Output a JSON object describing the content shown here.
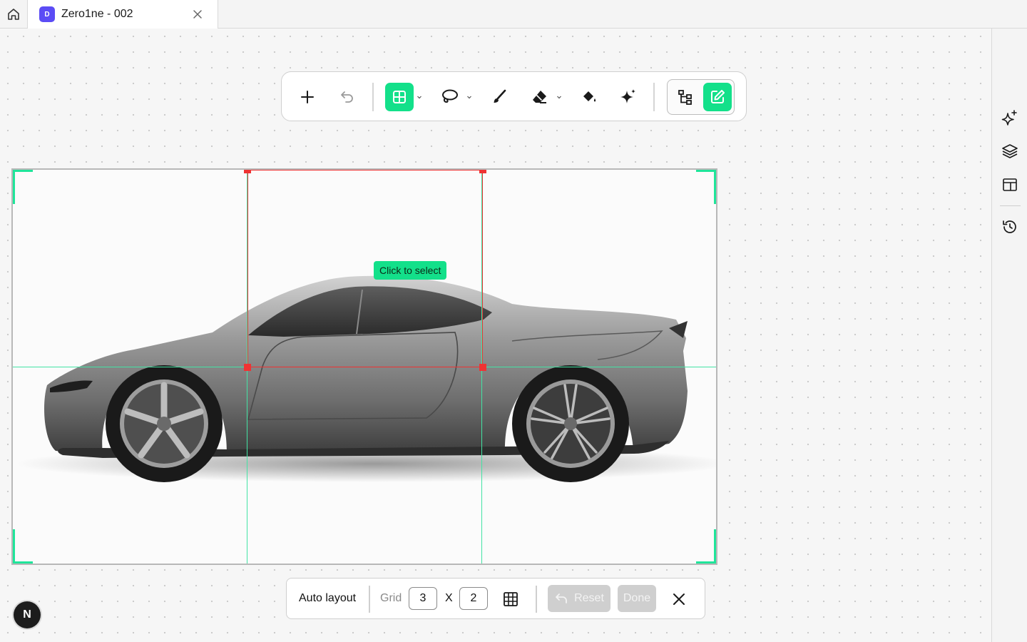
{
  "tab": {
    "badge": "D",
    "title": "Zero1ne - 002"
  },
  "toolbar": {
    "tools": [
      "add-icon",
      "undo-icon",
      "grid-layout-icon",
      "lasso-icon",
      "brush-icon",
      "eraser-icon",
      "fill-bucket-icon",
      "ai-sparkle-icon",
      "tree-structure-icon",
      "edit-icon"
    ],
    "active_tool": "grid-layout-icon",
    "accent_color": "#13e08a"
  },
  "canvas": {
    "hint": "Click to select",
    "selection_color": "#ef3333",
    "gridline_color": "#43e3a4"
  },
  "gridbar": {
    "auto_layout_label": "Auto layout",
    "grid_label": "Grid",
    "columns": "3",
    "separator": "X",
    "rows": "2",
    "reset_label": "Reset",
    "done_label": "Done"
  },
  "sidebar": {
    "items": [
      "ai-sparkle-icon",
      "layers-icon",
      "layout-icon",
      "history-icon"
    ]
  },
  "user": {
    "initial": "N"
  }
}
